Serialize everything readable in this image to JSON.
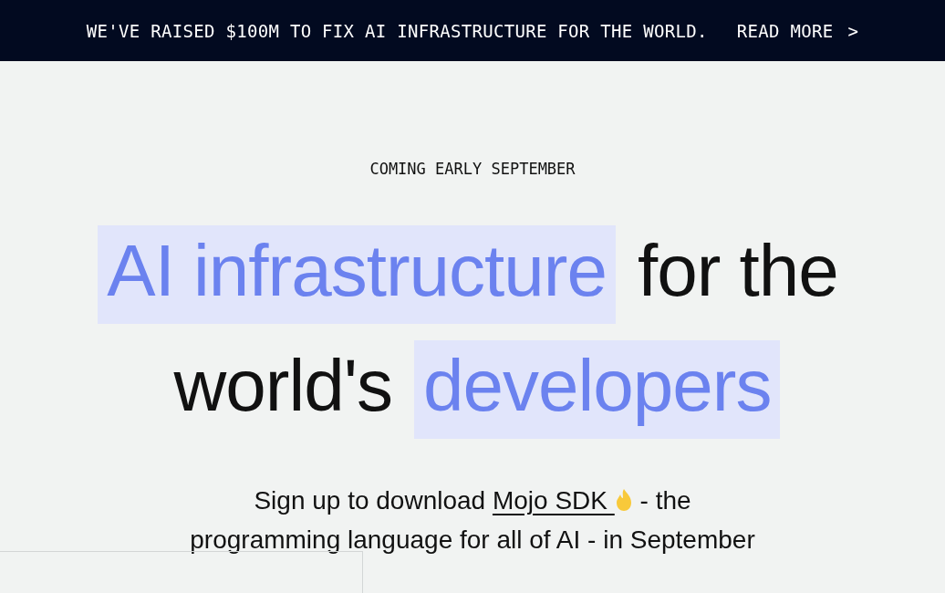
{
  "banner": {
    "text": "WE'VE RAISED $100M TO FIX AI INFRASTRUCTURE FOR THE WORLD.",
    "link": "READ MORE",
    "chevron": ">"
  },
  "eyebrow": "COMING EARLY SEPTEMBER",
  "headline": [
    [
      {
        "text": "AI infrastructure",
        "highlighted": true
      },
      {
        "text": "for the",
        "highlighted": false
      }
    ],
    [
      {
        "text": "world's",
        "highlighted": false
      },
      {
        "text": "developers",
        "highlighted": true
      }
    ]
  ],
  "subtitle": {
    "before": "Sign up to download",
    "link": "Mojo SDK",
    "after": "- the programming language for all of AI - in September"
  }
}
